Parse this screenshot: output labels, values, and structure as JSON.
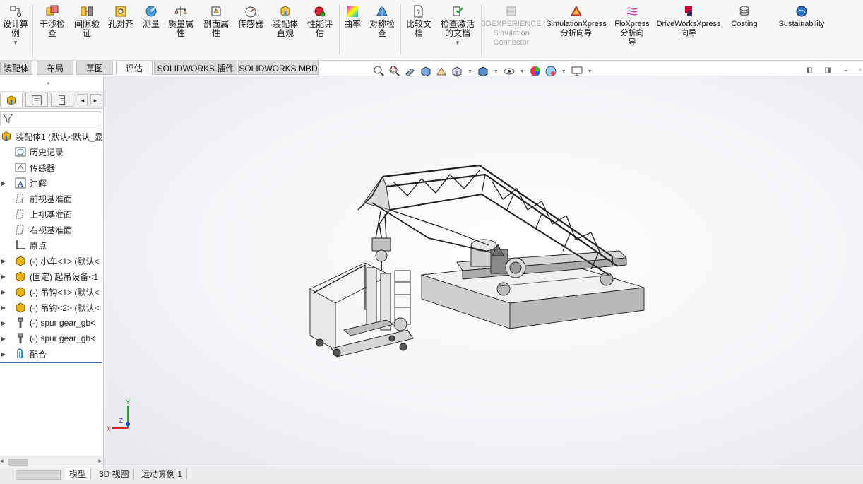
{
  "ribbon": {
    "design_study": "设计算\n例",
    "interference": "干涉检\n查",
    "clearance": "间隙验\n证",
    "hole_align": "孔对齐",
    "measure": "测量",
    "mass_props": "质量属\n性",
    "section_props": "剖面属\n性",
    "sensor": "传感器",
    "asm_visual": "装配体\n直观",
    "perf_eval": "性能评\n估",
    "curvature": "曲率",
    "symmetry": "对称检\n查",
    "compare": "比较文\n档",
    "check_active": "检查激活\n的文档",
    "exp_connector": "3DEXPERIENCE\nSimulation\nConnector",
    "simxpress": "SimulationXpress\n分析向导",
    "floxpress": "FloXpress\n分析向\n导",
    "driveworks": "DriveWorksXpress\n向导",
    "costing": "Costing",
    "sustainability": "Sustainability"
  },
  "tabs": [
    "装配体",
    "布局",
    "草图",
    "评估",
    "SOLIDWORKS 插件",
    "SOLIDWORKS MBD"
  ],
  "active_tab": "评估",
  "tree": {
    "root": "装配体1  (默认<默认_显",
    "items": [
      "历史记录",
      "传感器",
      "注解",
      "前视基准面",
      "上视基准面",
      "右视基准面",
      "原点",
      "(-) 小车<1> (默认<",
      "(固定) 起吊设备<1",
      "(-) 吊钩<1> (默认<",
      "(-) 吊钩<2> (默认<",
      "(-) spur gear_gb<",
      "(-) spur gear_gb<",
      "配合"
    ]
  },
  "bottom_tabs": [
    "模型",
    "3D 视图",
    "运动算例 1"
  ],
  "triad": {
    "x": "X",
    "y": "Y",
    "z": "Z"
  },
  "colors": {
    "accent": "#1f6fbf",
    "part_gray": "#d0d0d0",
    "tree_icon_yellow": "#e8b418"
  }
}
